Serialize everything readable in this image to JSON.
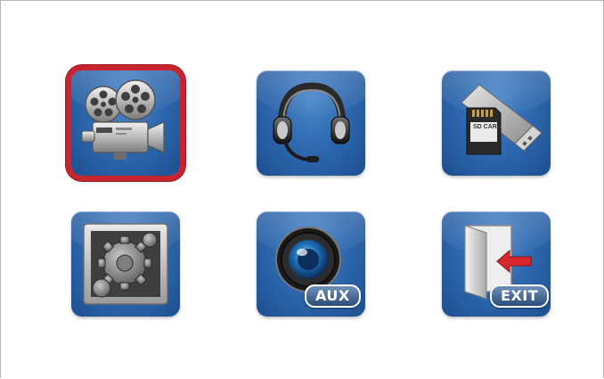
{
  "menu": {
    "tiles": [
      {
        "id": "video",
        "icon": "video-camera-icon",
        "selected": true
      },
      {
        "id": "audio",
        "icon": "headset-icon",
        "selected": false
      },
      {
        "id": "storage",
        "icon": "sd-card-usb-icon",
        "selected": false,
        "label": "SD CARD"
      },
      {
        "id": "settings",
        "icon": "gears-icon",
        "selected": false
      },
      {
        "id": "aux",
        "icon": "camera-lens-icon",
        "selected": false,
        "label": "AUX"
      },
      {
        "id": "exit",
        "icon": "exit-door-icon",
        "selected": false,
        "label": "EXIT"
      }
    ]
  },
  "colors": {
    "tile_blue": "#2f69b0",
    "selection_red": "#c8242f",
    "exit_arrow": "#d8262c"
  }
}
